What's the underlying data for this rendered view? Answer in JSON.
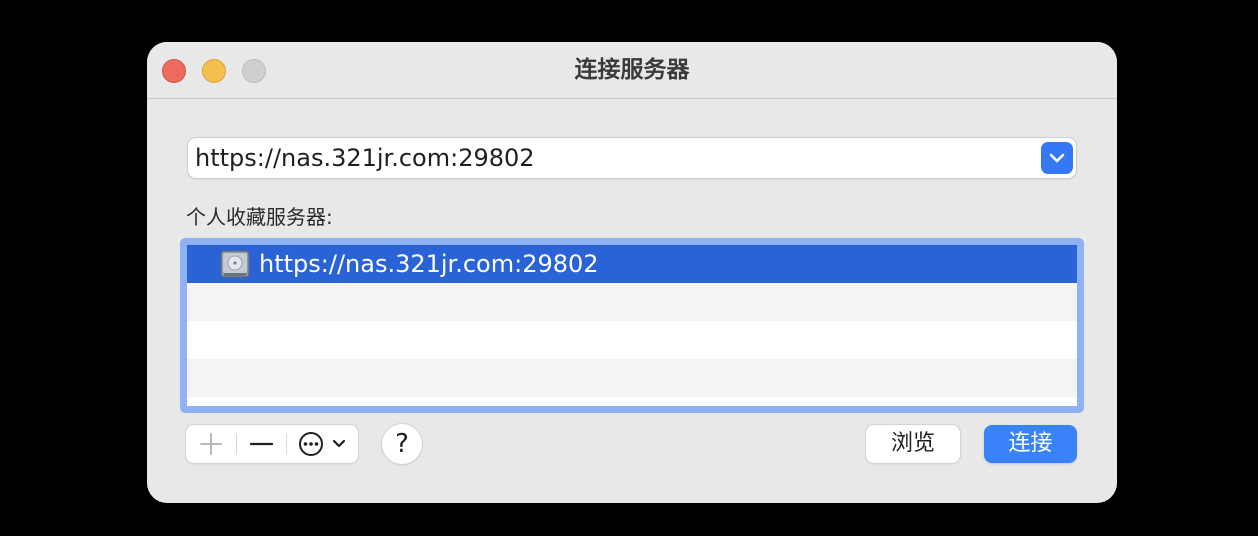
{
  "window": {
    "title": "连接服务器"
  },
  "address": {
    "value": "https://nas.321jr.com:29802"
  },
  "favorites": {
    "label": "个人收藏服务器:",
    "items": [
      {
        "label": "https://nas.321jr.com:29802",
        "icon": "server-drive-icon",
        "selected": true
      }
    ]
  },
  "toolbar": {
    "add_icon": "plus-icon",
    "remove_icon": "minus-icon",
    "more_icon": "ellipsis-circle-icon",
    "help_label": "?"
  },
  "buttons": {
    "browse_label": "浏览",
    "connect_label": "连接"
  },
  "colors": {
    "accent": "#3a82f7",
    "selection": "#2a63d6",
    "close": "#ed6a5e",
    "minimize": "#f5bf4f",
    "zoom_disabled": "#cfcfcf"
  }
}
